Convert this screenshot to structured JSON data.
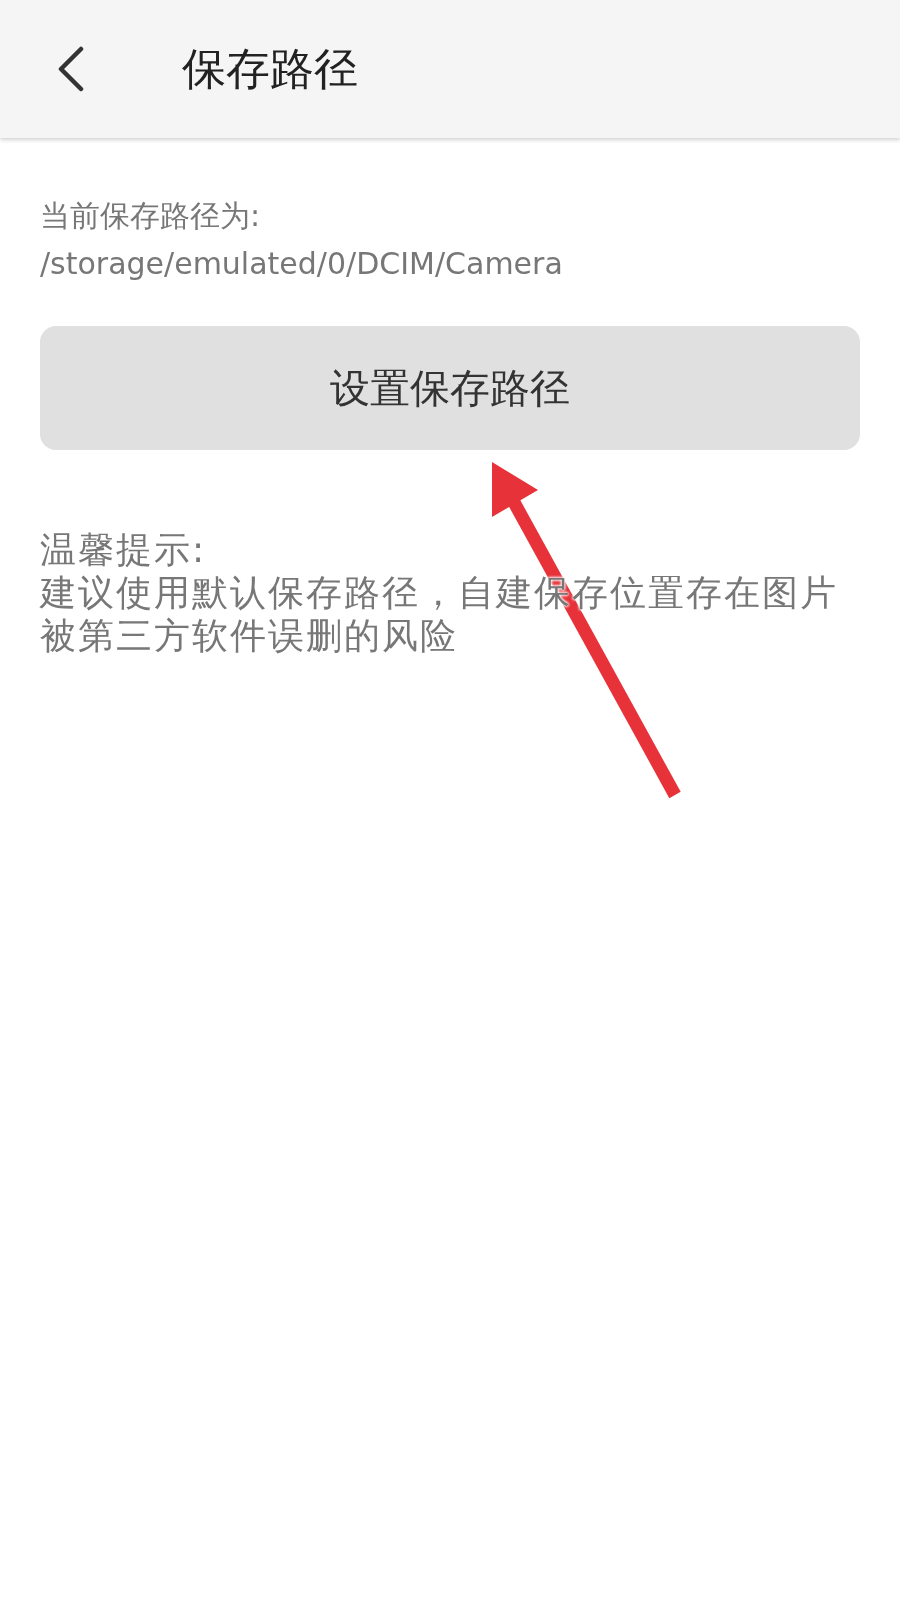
{
  "header": {
    "title": "保存路径"
  },
  "current_path": {
    "label": "当前保存路径为:",
    "value": "/storage/emulated/0/DCIM/Camera"
  },
  "button": {
    "label": "设置保存路径"
  },
  "tip": {
    "title": "温馨提示:",
    "text": "建议使用默认保存路径，自建保存位置存在图片被第三方软件误删的风险"
  }
}
